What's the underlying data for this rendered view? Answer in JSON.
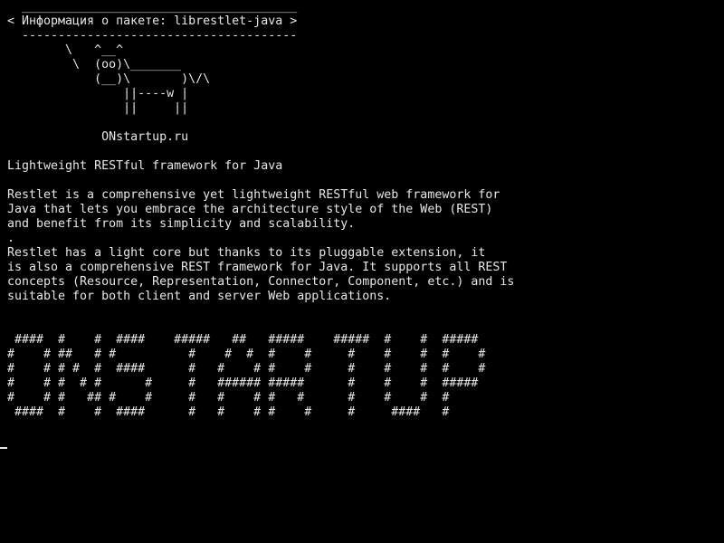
{
  "terminal": {
    "screen_text": "  ______________________________________\n< Информация о пакете: librestlet-java >\n  --------------------------------------\n        \\   ^__^\n         \\  (oo)\\_______\n            (__)\\       )\\/\\\n                ||----w |\n                ||     ||\n\n             ONstartup.ru\n\nLightweight RESTful framework for Java\n\nRestlet is a comprehensive yet lightweight RESTful web framework for\nJava that lets you embrace the architecture style of the Web (REST)\nand benefit from its simplicity and scalability.\n.\nRestlet has a light core but thanks to its pluggable extension, it\nis also a comprehensive REST framework for Java. It supports all REST\nconcepts (Resource, Representation, Connector, Component, etc.) and is\nsuitable for both client and server Web applications.\n\n\n ####  #    #  ####    #####   ##   #####    #####  #    #  #####\n#    # ##   # #          #    #  #  #    #     #    #    #  #    #\n#    # # #  #  ####      #   #    # #    #     #    #    #  #    #\n#    # #  # #      #     #   ###### #####      #    #    #  #####\n#    # #   ## #    #     #   #    # #   #      #    #    #  #\n ####  #    #  ####      #   #    # #    #     #     ####   #",
    "fg_color": "#e6e6e6",
    "bg_color": "#000000"
  }
}
